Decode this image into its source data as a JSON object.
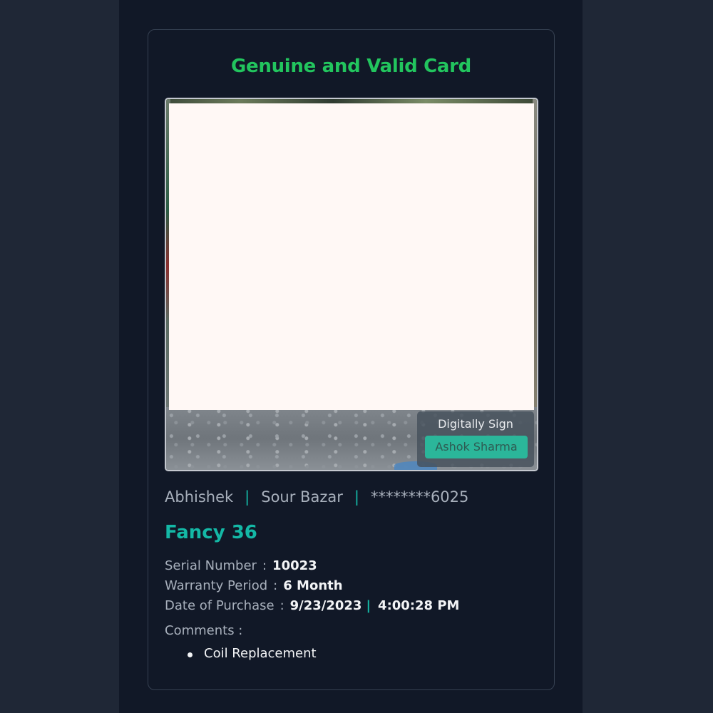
{
  "card": {
    "title": "Genuine and Valid Card",
    "signature": {
      "label": "Digitally Sign",
      "name": "Ashok Sharma"
    },
    "customer": {
      "name": "Abhishek",
      "location": "Sour Bazar",
      "phone_masked": "********6025",
      "separator": "|"
    },
    "product_name": "Fancy 36",
    "details": {
      "serial_label": "Serial Number",
      "serial_value": "10023",
      "warranty_label": "Warranty Period",
      "warranty_value": "6 Month",
      "purchase_label": "Date of Purchase",
      "purchase_date": "9/23/2023",
      "purchase_time": "4:00:28 PM",
      "colon": ":",
      "pipe": "|"
    },
    "comments_label": "Comments :",
    "comments": [
      "Coil Replacement"
    ]
  },
  "colors": {
    "title_green": "#22c55e",
    "accent_teal": "#14b8a6",
    "background": "#111827",
    "outer_background": "#1f2736"
  }
}
